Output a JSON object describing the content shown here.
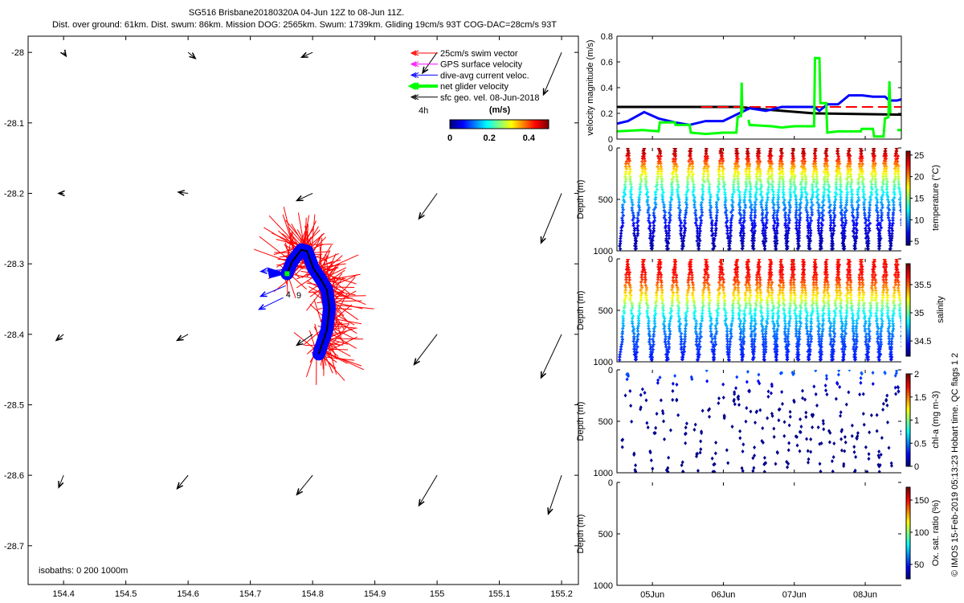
{
  "title": {
    "line1": "SG516 Brisbane20180320A 04-Jun 12Z to 08-Jun 11Z.",
    "line2": "Dist. over ground: 61km. Dist. swum: 86km. Mission DOG: 2565km. Swum: 1739km. Gliding 19cm/s 93T COG-DAC=28cm/s 93T"
  },
  "map": {
    "xlim": [
      154.343,
      155.227
    ],
    "ylim": [
      -28.755,
      -27.977
    ],
    "xticks": [
      {
        "v": 154.4,
        "label": "154.4"
      },
      {
        "v": 154.5,
        "label": "154.5"
      },
      {
        "v": 154.6,
        "label": "154.6"
      },
      {
        "v": 154.7,
        "label": "154.7"
      },
      {
        "v": 154.8,
        "label": "154.8"
      },
      {
        "v": 154.9,
        "label": "154.9"
      },
      {
        "v": 155.0,
        "label": "155"
      },
      {
        "v": 155.1,
        "label": "155.1"
      },
      {
        "v": 155.2,
        "label": "155.2"
      }
    ],
    "yticks": [
      {
        "v": -28.0,
        "label": "-28"
      },
      {
        "v": -28.1,
        "label": "-28.1"
      },
      {
        "v": -28.2,
        "label": "-28.2"
      },
      {
        "v": -28.3,
        "label": "-28.3"
      },
      {
        "v": -28.4,
        "label": "-28.4"
      },
      {
        "v": -28.5,
        "label": "-28.5"
      },
      {
        "v": -28.6,
        "label": "-28.6"
      },
      {
        "v": -28.7,
        "label": "-28.7"
      }
    ],
    "isobaths_label": "isobaths: 0   200  1000m",
    "legend": [
      {
        "label": "25cm/s swim vector",
        "color": "#ff0000"
      },
      {
        "label": "GPS surface velocity",
        "color": "#ff00ff"
      },
      {
        "label": "dive-avg current veloc.",
        "color": "#0000ff"
      },
      {
        "label": "net glider velocity",
        "color": "#00ff00"
      },
      {
        "label": "sfc geo. vel. 08-Jun-2018",
        "color": "#000000"
      }
    ],
    "legend_interval": "4h",
    "colorbar": {
      "label": "(m/s)",
      "range": [
        0,
        0.5
      ],
      "ticks": [
        {
          "v": 0,
          "label": "0"
        },
        {
          "v": 0.2,
          "label": "0.2"
        },
        {
          "v": 0.4,
          "label": "0.4"
        }
      ]
    },
    "track": {
      "lon": [
        154.759,
        154.767,
        154.782,
        154.791,
        154.801,
        154.814,
        154.823,
        154.827,
        154.823,
        154.814,
        154.81
      ],
      "lat": [
        -28.314,
        -28.297,
        -28.28,
        -28.282,
        -28.306,
        -28.323,
        -28.337,
        -28.363,
        -28.394,
        -28.417,
        -28.428
      ]
    },
    "dive_labels": [
      {
        "text": "4",
        "lon": 154.757,
        "lat": -28.348
      },
      {
        "text": "9",
        "lon": 154.774,
        "lat": -28.349
      }
    ],
    "geo_vectors_ms": [
      {
        "lon": 154.4,
        "lat": -28.0,
        "u": 0.02,
        "v": -0.03
      },
      {
        "lon": 154.6,
        "lat": -28.0,
        "u": 0.06,
        "v": -0.05
      },
      {
        "lon": 154.8,
        "lat": -28.0,
        "u": -0.09,
        "v": -0.04
      },
      {
        "lon": 155.0,
        "lat": -28.0,
        "u": -0.12,
        "v": -0.17
      },
      {
        "lon": 155.2,
        "lat": -28.0,
        "u": -0.15,
        "v": -0.35
      },
      {
        "lon": 154.4,
        "lat": -28.2,
        "u": -0.04,
        "v": 0.0
      },
      {
        "lon": 154.6,
        "lat": -28.2,
        "u": -0.08,
        "v": 0.01
      },
      {
        "lon": 154.8,
        "lat": -28.2,
        "u": -0.13,
        "v": -0.06
      },
      {
        "lon": 155.0,
        "lat": -28.2,
        "u": -0.15,
        "v": -0.21
      },
      {
        "lon": 155.2,
        "lat": -28.2,
        "u": -0.17,
        "v": -0.41
      },
      {
        "lon": 154.4,
        "lat": -28.4,
        "u": -0.06,
        "v": -0.05
      },
      {
        "lon": 154.6,
        "lat": -28.4,
        "u": -0.09,
        "v": -0.05
      },
      {
        "lon": 154.8,
        "lat": -28.4,
        "u": -0.13,
        "v": -0.09
      },
      {
        "lon": 155.0,
        "lat": -28.4,
        "u": -0.19,
        "v": -0.25
      },
      {
        "lon": 155.2,
        "lat": -28.4,
        "u": -0.17,
        "v": -0.36
      },
      {
        "lon": 154.4,
        "lat": -28.6,
        "u": -0.04,
        "v": -0.1
      },
      {
        "lon": 154.6,
        "lat": -28.6,
        "u": -0.09,
        "v": -0.11
      },
      {
        "lon": 154.8,
        "lat": -28.6,
        "u": -0.13,
        "v": -0.16
      },
      {
        "lon": 155.0,
        "lat": -28.6,
        "u": -0.15,
        "v": -0.25
      },
      {
        "lon": 155.2,
        "lat": -28.6,
        "u": -0.11,
        "v": -0.32
      }
    ],
    "current_vectors_ms": [
      {
        "lon": 154.759,
        "lat": -28.308,
        "u": -0.27,
        "v": -0.02
      },
      {
        "lon": 154.757,
        "lat": -28.331,
        "u": -0.26,
        "v": -0.11
      },
      {
        "lon": 154.753,
        "lat": -28.348,
        "u": -0.25,
        "v": -0.12
      }
    ]
  },
  "chart_data": [
    {
      "type": "line",
      "ylabel": "velocity magnitude (m/s)",
      "xlim": [
        "2018-06-04T12:00",
        "2018-06-08T12:30"
      ],
      "ylim": [
        0,
        0.8
      ],
      "yticks": [
        {
          "v": 0,
          "label": "0"
        },
        {
          "v": 0.2,
          "label": "0.2"
        },
        {
          "v": 0.4,
          "label": "0.4"
        },
        {
          "v": 0.6,
          "label": "0.6"
        },
        {
          "v": 0.8,
          "label": "0.8"
        }
      ],
      "series": [
        {
          "color": "#000000",
          "dash": false,
          "points": [
            [
              "2018-06-04T12:00",
              0.25
            ],
            [
              "2018-06-06T06:12",
              0.25
            ],
            [
              "2018-06-06T08:54",
              0.24
            ],
            [
              "2018-06-07T06:42",
              0.2
            ],
            [
              "2018-06-08T12:24",
              0.19
            ]
          ]
        },
        {
          "color": "#ff0000",
          "dash": true,
          "points": [
            [
              "2018-06-05T16:30",
              0.25
            ],
            [
              "2018-06-08T12:24",
              0.25
            ]
          ]
        },
        {
          "color": "#0000ff",
          "dash": false,
          "points": [
            [
              "2018-06-04T12:00",
              0.12
            ],
            [
              "2018-06-04T15:42",
              0.14
            ],
            [
              "2018-06-04T21:12",
              0.21
            ],
            [
              "2018-06-05T02:06",
              0.16
            ],
            [
              "2018-06-05T07:36",
              0.13
            ],
            [
              "2018-06-05T12:30",
              0.11
            ],
            [
              "2018-06-05T18:00",
              0.14
            ],
            [
              "2018-06-05T23:54",
              0.14
            ],
            [
              "2018-06-06T06:12",
              0.21
            ],
            [
              "2018-06-06T08:54",
              0.24
            ],
            [
              "2018-06-06T14:24",
              0.22
            ],
            [
              "2018-06-06T19:48",
              0.25
            ],
            [
              "2018-06-07T06:42",
              0.25
            ],
            [
              "2018-06-07T08:30",
              0.22
            ],
            [
              "2018-06-07T11:12",
              0.27
            ],
            [
              "2018-06-07T14:48",
              0.27
            ],
            [
              "2018-06-07T18:30",
              0.34
            ],
            [
              "2018-06-07T23:00",
              0.34
            ],
            [
              "2018-06-08T02:36",
              0.33
            ],
            [
              "2018-06-08T06:42",
              0.33
            ],
            [
              "2018-06-08T08:06",
              0.3
            ],
            [
              "2018-06-08T10:48",
              0.3
            ],
            [
              "2018-06-08T12:24",
              0.31
            ]
          ]
        },
        {
          "color": "#00ff00",
          "dash": false,
          "points": [
            [
              "2018-06-04T12:00",
              0.06
            ],
            [
              "2018-06-04T20:42",
              0.07
            ],
            [
              "2018-06-05T02:06",
              0.06
            ],
            [
              "2018-06-05T02:30",
              0.13
            ],
            [
              "2018-06-05T07:36",
              0.13
            ],
            [
              "2018-06-05T07:50",
              0.11
            ],
            [
              "2018-06-05T12:36",
              0.11
            ],
            [
              "2018-06-05T13:00",
              0.05
            ],
            [
              "2018-06-05T18:00",
              0.04
            ],
            [
              "2018-06-05T23:54",
              0.05
            ],
            [
              "2018-06-06T04:24",
              0.05
            ],
            [
              "2018-06-06T04:50",
              0.17
            ],
            [
              "2018-06-06T06:00",
              0.18
            ],
            [
              "2018-06-06T06:12",
              0.44
            ],
            [
              "2018-06-06T06:24",
              0.2
            ],
            null,
            [
              "2018-06-06T08:30",
              0.15
            ],
            [
              "2018-06-06T08:54",
              0.11
            ],
            [
              "2018-06-06T16:12",
              0.1
            ],
            [
              "2018-06-06T19:48",
              0.09
            ],
            [
              "2018-06-06T23:54",
              0.1
            ],
            [
              "2018-06-07T06:42",
              0.1
            ],
            [
              "2018-06-07T07:00",
              0.63
            ],
            [
              "2018-06-07T08:30",
              0.63
            ],
            [
              "2018-06-07T08:50",
              0.28
            ],
            [
              "2018-06-07T10:48",
              0.28
            ],
            [
              "2018-06-07T11:10",
              0.05
            ],
            [
              "2018-06-07T14:48",
              0.06
            ],
            [
              "2018-06-07T22:30",
              0.06
            ],
            [
              "2018-06-07T22:50",
              0.08
            ],
            [
              "2018-06-08T02:36",
              0.08
            ],
            [
              "2018-06-08T03:00",
              0.02
            ],
            [
              "2018-06-08T06:12",
              0.02
            ],
            [
              "2018-06-08T06:40",
              0.16
            ],
            [
              "2018-06-08T07:50",
              0.17
            ],
            [
              "2018-06-08T08:12",
              0.45
            ],
            [
              "2018-06-08T08:30",
              0.2
            ],
            null,
            [
              "2018-06-08T10:48",
              0.07
            ],
            [
              "2018-06-08T12:24",
              0.07
            ]
          ]
        }
      ]
    },
    {
      "type": "scatter",
      "ylabel": "Depth (m)",
      "ylim": [
        1000,
        0
      ],
      "yticks": [
        {
          "v": 0,
          "label": "0"
        },
        {
          "v": 500,
          "label": "500"
        },
        {
          "v": 1000,
          "label": "1000"
        }
      ],
      "colorbar": {
        "label": "temperature (°C)",
        "range": [
          4.1,
          25.9
        ],
        "ticks": [
          {
            "v": 5,
            "label": "5"
          },
          {
            "v": 10,
            "label": "10"
          },
          {
            "v": 15,
            "label": "15"
          },
          {
            "v": 20,
            "label": "20"
          },
          {
            "v": 25,
            "label": "25"
          }
        ]
      },
      "profile": {
        "depth": [
          0,
          50,
          100,
          200,
          300,
          400,
          500,
          600,
          700,
          800,
          1000
        ],
        "value": [
          25,
          24.5,
          23,
          19,
          16,
          13,
          11,
          9,
          7.5,
          6,
          4.8
        ]
      },
      "marker": "plus"
    },
    {
      "type": "scatter",
      "ylabel": "Depth (m)",
      "ylim": [
        1000,
        0
      ],
      "yticks": [
        {
          "v": 0,
          "label": "0"
        },
        {
          "v": 500,
          "label": "500"
        },
        {
          "v": 1000,
          "label": "1000"
        }
      ],
      "colorbar": {
        "label": "salinity",
        "range": [
          34.23,
          35.87
        ],
        "ticks": [
          {
            "v": 34.5,
            "label": "34.5"
          },
          {
            "v": 35,
            "label": "35"
          },
          {
            "v": 35.5,
            "label": "35.5"
          }
        ]
      },
      "profile": {
        "depth": [
          0,
          100,
          200,
          300,
          400,
          500,
          600,
          800,
          1000
        ],
        "value": [
          35.62,
          35.68,
          35.6,
          35.4,
          35.2,
          34.9,
          34.75,
          34.55,
          34.45
        ]
      },
      "marker": "plus"
    },
    {
      "type": "scatter",
      "ylabel": "Depth (m)",
      "ylim": [
        1000,
        0
      ],
      "yticks": [
        {
          "v": 0,
          "label": "0"
        },
        {
          "v": 500,
          "label": "500"
        },
        {
          "v": 1000,
          "label": "1000"
        }
      ],
      "colorbar": {
        "label": "chl-a (mg m-3)",
        "range": [
          0,
          2
        ],
        "ticks": [
          {
            "v": 0,
            "label": "0"
          },
          {
            "v": 0.5,
            "label": "0.5"
          },
          {
            "v": 1,
            "label": "1"
          },
          {
            "v": 1.5,
            "label": "1.5"
          },
          {
            "v": 2,
            "label": "2"
          }
        ]
      },
      "profile": {
        "depth": [
          0,
          50,
          100,
          150,
          200,
          300,
          1000
        ],
        "value": [
          0.45,
          0.4,
          0.3,
          0.15,
          0.08,
          0.03,
          0.02
        ]
      },
      "marker": "diamond"
    },
    {
      "type": "scatter",
      "ylabel": "Depth (m)",
      "ylim": [
        1000,
        0
      ],
      "yticks": [
        {
          "v": 0,
          "label": "0"
        },
        {
          "v": 500,
          "label": "500"
        },
        {
          "v": 1000,
          "label": "1000"
        }
      ],
      "colorbar": {
        "label": "Ox. sat. ratio (%)",
        "range": [
          27.5,
          170
        ],
        "ticks": [
          {
            "v": 50,
            "label": "50"
          },
          {
            "v": 100,
            "label": "100"
          },
          {
            "v": 150,
            "label": "150"
          }
        ]
      },
      "profile": null,
      "marker": "none"
    }
  ],
  "dives": {
    "max_depth": 1000,
    "surface_times": [
      "2018-06-04T15:42",
      "2018-06-04T21:00",
      "2018-06-05T02:24",
      "2018-06-05T07:36",
      "2018-06-05T12:54",
      "2018-06-05T18:12",
      "2018-06-05T23:18",
      "2018-06-06T04:30",
      "2018-06-06T08:18",
      "2018-06-06T11:54",
      "2018-06-06T15:54",
      "2018-06-06T19:36",
      "2018-06-06T23:30",
      "2018-06-07T03:06",
      "2018-06-07T07:00",
      "2018-06-07T10:48",
      "2018-06-07T14:54",
      "2018-06-07T18:30",
      "2018-06-07T22:36",
      "2018-06-08T02:54",
      "2018-06-08T06:42",
      "2018-06-08T10:36"
    ]
  },
  "time_axis": {
    "ticks": [
      {
        "t": "2018-06-05T00:00",
        "label": "05Jun"
      },
      {
        "t": "2018-06-06T00:00",
        "label": "06Jun"
      },
      {
        "t": "2018-06-07T00:00",
        "label": "07Jun"
      },
      {
        "t": "2018-06-08T00:00",
        "label": "08Jun"
      }
    ]
  },
  "credit": "© IMOS 15-Feb-2019 05:13:23 Hobart time. QC flags 1  2"
}
